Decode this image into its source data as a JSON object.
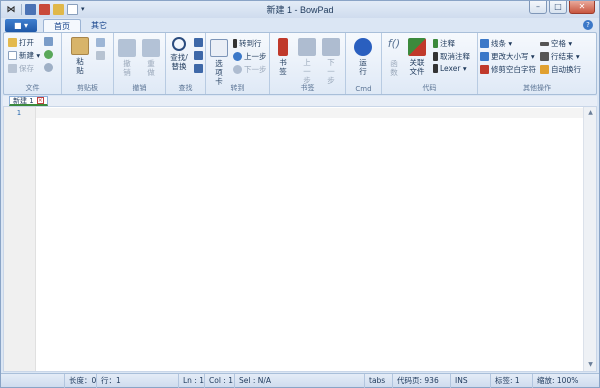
{
  "window": {
    "title": "新建 1 - BowPad"
  },
  "titlebar": {
    "app_icon": "⋈",
    "quick_access": [
      "save-icon",
      "close-doc-icon",
      "open-icon",
      "new-icon",
      "dropdown-icon"
    ],
    "minimize": "–",
    "maximize": "□",
    "close": "✕"
  },
  "menu": {
    "file_btn": "■ ▾",
    "tabs": [
      "首页",
      "其它"
    ],
    "help": "?"
  },
  "ribbon": {
    "file": {
      "label": "文件",
      "open": "打开",
      "new": "新建",
      "save": "保存"
    },
    "clipboard": {
      "label": "剪贴板",
      "paste": "粘贴"
    },
    "undo": {
      "label": "撤销",
      "undo": "撤销",
      "redo": "重做"
    },
    "find": {
      "label": "查找",
      "find_replace": "查找/替换"
    },
    "goto": {
      "label": "转到",
      "tabs": "选项卡",
      "goto_line": "转到行",
      "prev": "上一步",
      "next": "下一步"
    },
    "bookmarks": {
      "label": "书签",
      "bookmark": "书签",
      "prev": "上一步",
      "next": "下一步"
    },
    "cmd": {
      "label": "Cmd",
      "run": "运行"
    },
    "code": {
      "label": "代码",
      "func": "函数",
      "assoc": "关联文件",
      "comment": "注释",
      "uncomment": "取消注释",
      "lexer": "Lexer"
    },
    "other": {
      "label": "其他操作",
      "lines": "线条",
      "case": "更改大小写",
      "trim": "修剪空白字符",
      "spaces": "空格",
      "eol": "行结束",
      "autowrap": "自动换行"
    }
  },
  "doc": {
    "tab_label": "新建 1",
    "line_number": "1"
  },
  "status": {
    "length": "长度：0",
    "lines": "行：1",
    "ln": "Ln : 1",
    "col": "Col : 1",
    "sel": "Sel : N/A",
    "tabs": "tabs",
    "encoding": "代码页: 936",
    "ins": "INS",
    "tabcount": "标签: 1",
    "zoom": "缩放: 100%"
  },
  "colors": {
    "accent": "#1f58a8",
    "ribbon_bg": "#dfe9f6",
    "bookmark_red": "#c0392b",
    "run_blue": "#2a5fbf"
  }
}
